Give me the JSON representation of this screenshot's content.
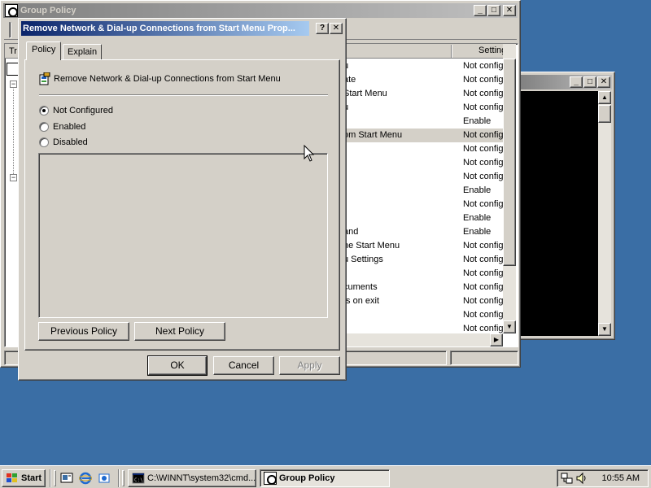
{
  "gp_window": {
    "title": "Group Policy",
    "tree_header_fragment": "Tr",
    "settings_column_header": "Setting",
    "settings_rows": [
      {
        "name": "u",
        "state": "Not configu"
      },
      {
        "name": "ate",
        "state": "Not configu"
      },
      {
        "name": "Start Menu",
        "state": "Not configu"
      },
      {
        "name": "u",
        "state": "Not configu"
      },
      {
        "name": "",
        "state": "Enable"
      },
      {
        "name": "om Start Menu",
        "state": "Not configu"
      },
      {
        "name": "",
        "state": "Not configu"
      },
      {
        "name": "",
        "state": "Not configu"
      },
      {
        "name": "",
        "state": "Not configu"
      },
      {
        "name": "",
        "state": "Enable"
      },
      {
        "name": "",
        "state": "Not configu"
      },
      {
        "name": "",
        "state": "Enable"
      },
      {
        "name": "and",
        "state": "Enable"
      },
      {
        "name": "he Start Menu",
        "state": "Not configu"
      },
      {
        "name": "u Settings",
        "state": "Not configu"
      },
      {
        "name": "",
        "state": "Not configu"
      },
      {
        "name": "cuments",
        "state": "Not configu"
      },
      {
        "name": "ts on exit",
        "state": "Not configu"
      },
      {
        "name": "",
        "state": "Not configu"
      },
      {
        "name": "",
        "state": "Not configu"
      }
    ]
  },
  "dialog": {
    "title": "Remove Network & Dial-up Connections from Start Menu Prop...",
    "help_button": "?",
    "close_button": "✕",
    "tabs": [
      {
        "label": "Policy",
        "active": true
      },
      {
        "label": "Explain",
        "active": false
      }
    ],
    "policy_name": "Remove Network & Dial-up Connections from Start Menu",
    "options": [
      {
        "label": "Not Configured",
        "selected": true
      },
      {
        "label": "Enabled",
        "selected": false
      },
      {
        "label": "Disabled",
        "selected": false
      }
    ],
    "previous_button": "Previous Policy",
    "next_button": "Next Policy",
    "ok_button": "OK",
    "cancel_button": "Cancel",
    "apply_button": "Apply"
  },
  "console_window": {
    "minimize": "_",
    "maximize": "□",
    "close": "✕"
  },
  "taskbar": {
    "start_label": "Start",
    "tasks": [
      {
        "label": "C:\\WINNT\\system32\\cmd...",
        "active": false
      },
      {
        "label": "Group Policy",
        "active": true
      }
    ],
    "clock": "10:55 AM"
  },
  "colors": {
    "desktop": "#3a6ea5",
    "title_active": "#0a246a",
    "title_inactive": "#808080",
    "face": "#d4d0c8"
  }
}
